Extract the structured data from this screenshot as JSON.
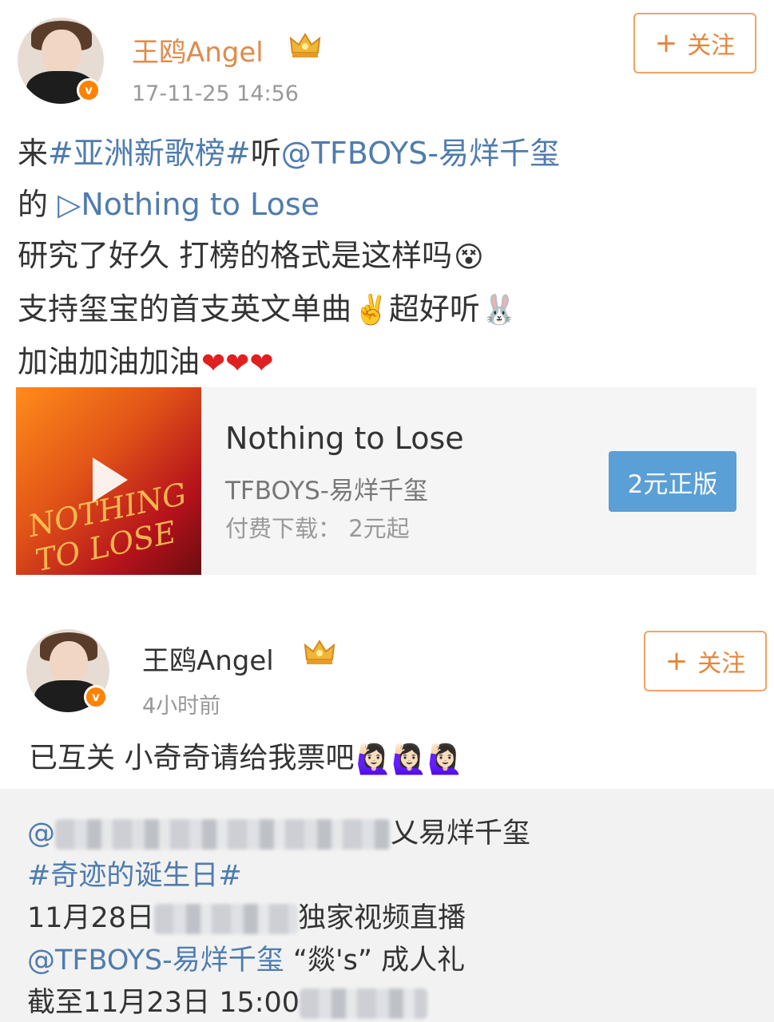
{
  "post1": {
    "username": "王鸥Angel",
    "time": "17-11-25 14:56",
    "follow_label": "关注",
    "follow_plus": "+",
    "verified_badge": "v",
    "lines": {
      "l1_a": "来",
      "l1_topic": "#亚洲新歌榜#",
      "l1_b": "听",
      "l1_mention": "@TFBOYS-易烊千玺",
      "l2_a": "的",
      "l2_link": "▷Nothing to Lose",
      "l3": "研究了好久 打榜的格式是这样吗",
      "l4_a": "支持玺宝的首支英文单曲",
      "l4_b": "超好听",
      "l5": "加油加油加油"
    },
    "emojis": {
      "glasses": "😵",
      "victory": "✌️",
      "bunny": "🐰",
      "hearts": "❤❤❤"
    },
    "music_card": {
      "title": "Nothing to Lose",
      "artist": "TFBOYS-易烊千玺",
      "price_text": "付费下载：  2元起",
      "buy_label": "2元正版",
      "cover_art_text": "NOTHING TO LOSE"
    }
  },
  "post2": {
    "username": "王鸥Angel",
    "time": "4小时前",
    "follow_label": "关注",
    "follow_plus": "+",
    "verified_badge": "v",
    "reply_text": "已互关 小奇奇请给我票吧",
    "reply_emoji": "🙋🏻‍♀️🙋🏻‍♀️🙋🏻‍♀️",
    "repost": {
      "r1_prefix": "@",
      "r1_suffix": "乂易烊千玺",
      "r2": "#奇迹的诞生日#",
      "r3_a": "11月28日",
      "r3_b": "独家视频直播",
      "r4_mention": "@TFBOYS-易烊千玺",
      "r4_b": " “燚's” 成人礼",
      "r5_a": "截至11月23日 15:00"
    }
  },
  "colors": {
    "link": "#4f7cae",
    "username_vip": "#e08a4b",
    "follow_border": "#f3a264",
    "buy_button": "#5a9fd6",
    "verified": "#ff8200"
  }
}
